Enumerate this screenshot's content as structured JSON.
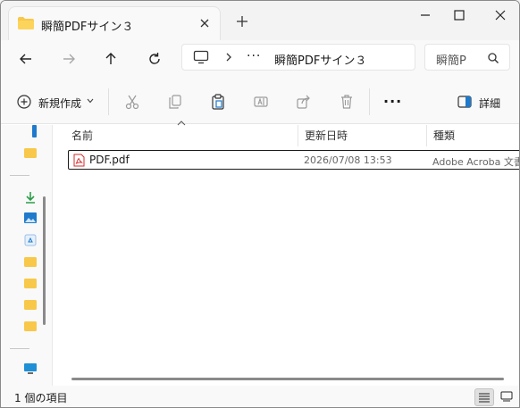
{
  "window": {
    "tab_title": "瞬簡PDFサイン３"
  },
  "address_bar": {
    "overflow": "···",
    "path": "瞬簡PDFサイン３",
    "search_placeholder": "瞬簡P"
  },
  "command_bar": {
    "new_label": "新規作成",
    "details_label": "詳細",
    "more": "···"
  },
  "columns": {
    "name": "名前",
    "date": "更新日時",
    "type": "種類"
  },
  "files": [
    {
      "name": "PDF.pdf",
      "date": "2026/07/08 13:53",
      "type": "Adobe Acroba 文書",
      "icon": "pdf-file-icon"
    }
  ],
  "status": {
    "item_count": "1 個の項目"
  },
  "colors": {
    "folder": "#f8c84a",
    "pdf_red": "#d42b2b",
    "accent_blue": "#1f7acc",
    "green_download": "#2a9d4a"
  }
}
